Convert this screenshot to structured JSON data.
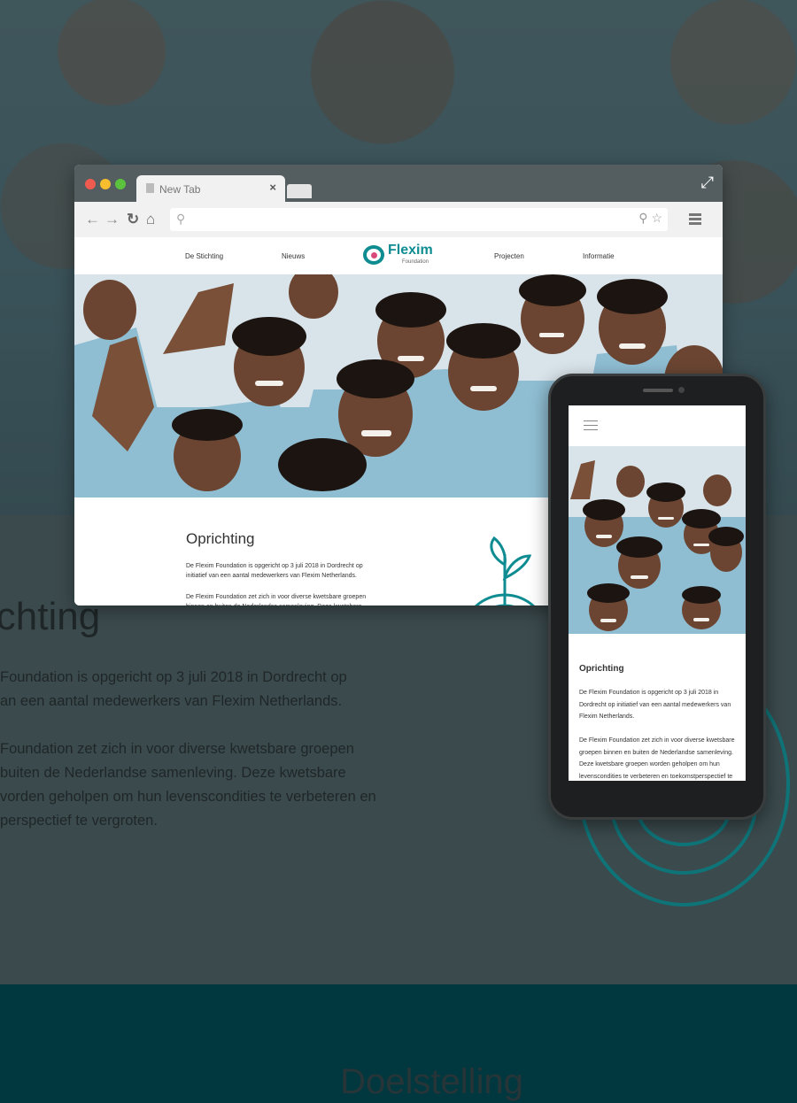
{
  "background": {
    "heading": "ichting",
    "paragraph1": "Foundation is opgericht op 3 juli 2018 in Dordrecht op\nan een aantal medewerkers van Flexim Netherlands.",
    "paragraph2": "Foundation zet zich in voor diverse kwetsbare groepen\nbuiten de Nederlandse samenleving. Deze kwetsbare\nvorden geholpen om hun levenscondities te verbeteren en\nperspectief te vergroten.",
    "footer_title": "Doelstelling"
  },
  "browser": {
    "tab_label": "New Tab",
    "tab_close": "×",
    "nav_links": [
      "De Stichting",
      "Nieuws",
      "Projecten",
      "Informatie"
    ],
    "logo_name": "Flexim",
    "logo_sub": "Foundation",
    "section_title": "Oprichting",
    "para1": "De Flexim Foundation is opgericht op 3 juli 2018 in Dordrecht op\ninitiatief van een aantal medewerkers van Flexim Netherlands.",
    "para2": "De Flexim Foundation zet zich in voor diverse kwetsbare groepen\nbinnen en buiten de Nederlandse samenleving. Deze kwetsbare"
  },
  "phone": {
    "section_title": "Oprichting",
    "para1": "De Flexim Foundation is opgericht op 3 juli 2018 in\nDordrecht op initiatief van een aantal medewerkers van\nFlexim Netherlands.",
    "para2": "De Flexim Foundation zet zich in voor diverse kwetsbare\ngroepen binnen en buiten de Nederlandse samenleving.\nDeze kwetsbare groepen worden geholpen om hun\nlevenscondities te verbeteren en toekomstperspectief te"
  },
  "icons": [
    "file-icon",
    "close-icon",
    "expand-icon",
    "back-icon",
    "forward-icon",
    "reload-icon",
    "home-icon",
    "search-icon",
    "star-icon",
    "menu-icon",
    "hamburger-icon",
    "plant-icon"
  ],
  "colors": {
    "teal": "#0f8c92",
    "footer": "#01383f",
    "accent_pink": "#d94a7a"
  }
}
